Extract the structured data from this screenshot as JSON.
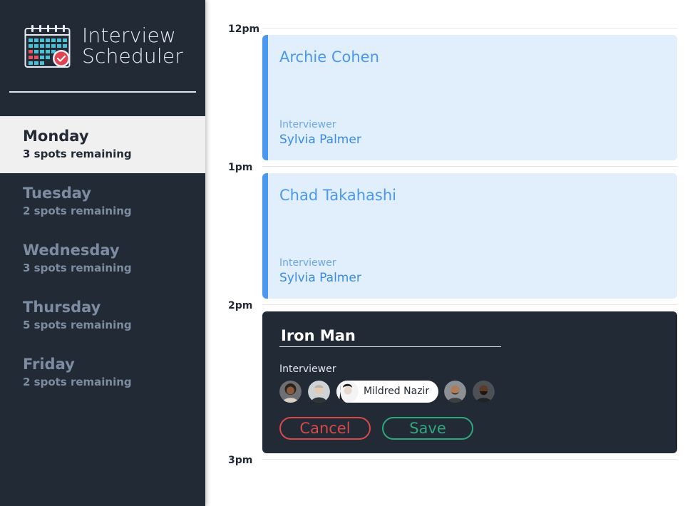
{
  "brand": {
    "title": "Interview\nScheduler",
    "logo_icon": "calendar-check-icon"
  },
  "days": [
    {
      "name": "Monday",
      "spots": "3 spots remaining",
      "selected": true
    },
    {
      "name": "Tuesday",
      "spots": "2 spots remaining",
      "selected": false
    },
    {
      "name": "Wednesday",
      "spots": "3 spots remaining",
      "selected": false
    },
    {
      "name": "Thursday",
      "spots": "5 spots remaining",
      "selected": false
    },
    {
      "name": "Friday",
      "spots": "2 spots remaining",
      "selected": false
    }
  ],
  "hours": [
    "12pm",
    "1pm",
    "2pm",
    "3pm"
  ],
  "appointments": [
    {
      "student": "Archie Cohen",
      "interviewer_label": "Interviewer",
      "interviewer": "Sylvia Palmer"
    },
    {
      "student": "Chad Takahashi",
      "interviewer_label": "Interviewer",
      "interviewer": "Sylvia Palmer"
    }
  ],
  "form": {
    "student_name": "Iron Man",
    "interviewer_label": "Interviewer",
    "selected_interviewer": "Mildred Nazir",
    "cancel_label": "Cancel",
    "save_label": "Save"
  },
  "colors": {
    "sidebar_bg": "#222a36",
    "appointment_bg": "#e1eefc",
    "appointment_accent": "#4a98f0",
    "cancel": "#d64a4a",
    "save": "#2fa67d"
  }
}
